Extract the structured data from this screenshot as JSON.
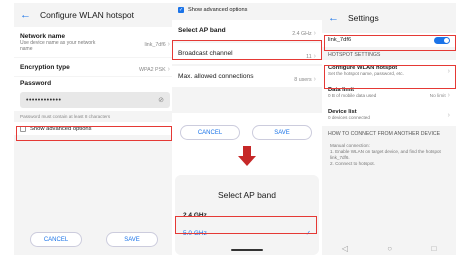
{
  "left": {
    "title": "Configure WLAN hotspot",
    "network_name_label": "Network name",
    "network_name_hint": "Use device name as your network name",
    "network_name_value": "link_7df6",
    "encryption_label": "Encryption type",
    "encryption_value": "WPA2 PSK",
    "password_label": "Password",
    "password_dots": "••••••••••••",
    "password_hint": "Password must contain at least 8 characters",
    "advanced_label": "Show advanced options",
    "cancel": "CANCEL",
    "save": "SAVE"
  },
  "middle": {
    "advanced_label": "Show advanced options",
    "rows": [
      {
        "label": "Select AP band",
        "value": "2.4 GHz"
      },
      {
        "label": "Broadcast channel",
        "value": "11"
      },
      {
        "label": "Max. allowed connections",
        "value": "8 users"
      }
    ],
    "cancel": "CANCEL",
    "save": "SAVE",
    "sheet_title": "Select AP band",
    "options": [
      "2.4 GHz",
      "5.0 GHz"
    ],
    "check": "✓"
  },
  "right": {
    "title": "Settings",
    "ssid": "link_7df6",
    "section_hotspot": "HOTSPOT SETTINGS",
    "configure_label": "Configure WLAN hotspot",
    "configure_sub": "Set the hotspot name, password, etc.",
    "data_limit_label": "Data limit",
    "data_limit_sub": "0 B of mobile data used",
    "data_limit_value": "No limit",
    "device_list_label": "Device list",
    "device_list_sub": "0 devices connected",
    "section_connect": "HOW TO CONNECT FROM ANOTHER DEVICE",
    "instructions_1": "Manual connection:",
    "instructions_2": "1. Enable WLAN on target device, and find the hotspot link_7df6.",
    "instructions_3": "2. Connect to hotspot."
  },
  "icons": {
    "back": "back-arrow-icon",
    "chevron": "chevron-right-icon",
    "eye": "eye-off-icon"
  },
  "colors": {
    "accent": "#1a73e8",
    "highlight": "#e53935",
    "arrow": "#c62828"
  }
}
